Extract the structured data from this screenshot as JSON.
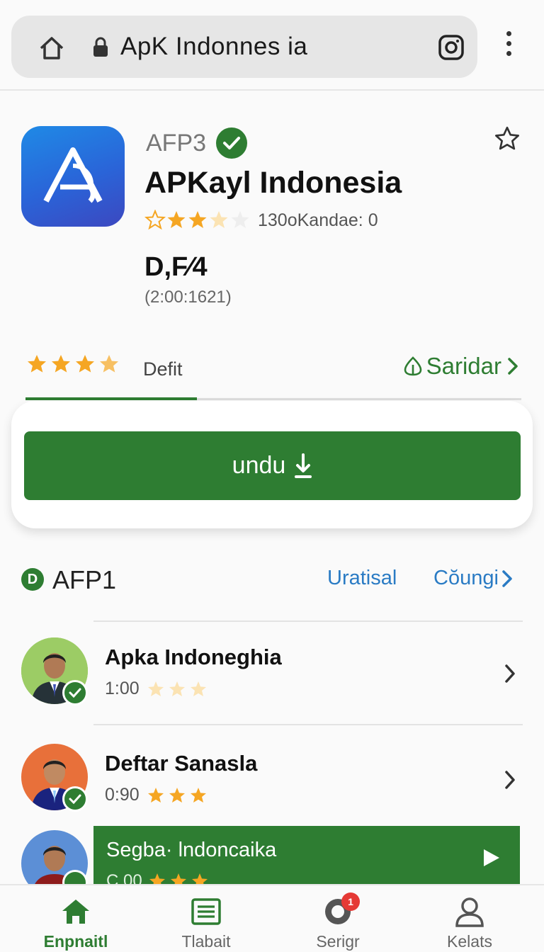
{
  "browser": {
    "url_text": "ApK Indonnes ia",
    "icons": [
      "home-icon",
      "lock-icon",
      "instagram-icon",
      "more-vert-icon"
    ]
  },
  "app": {
    "developer": "AFP3",
    "title": "APKayl Indonesia",
    "rating_count_text": "130oKandae: 0",
    "rating_fraction": 0.6,
    "size_big": "D,F⁄4",
    "size_small": "(2:00:1621)"
  },
  "tabs": {
    "label": "Defit",
    "right_label": "Saridar",
    "rating_fraction": 0.9
  },
  "download": {
    "label": "undu"
  },
  "section": {
    "badge": "D",
    "title": "AFP1",
    "link1": "Uratisal",
    "link2": "Cŏungi"
  },
  "list": [
    {
      "title": "Apka Indoneghia",
      "meta": "1:00",
      "stars_fraction": 0.0
    },
    {
      "title": "Deftar Sanasla",
      "meta": "0:90",
      "stars_fraction": 1.0
    }
  ],
  "featured": {
    "title": "Segba· lndoncaika",
    "meta": "C.00"
  },
  "nav": [
    {
      "label": "Enpnaitl",
      "icon": "home-icon",
      "active": true
    },
    {
      "label": "Tlabait",
      "icon": "list-icon",
      "active": false
    },
    {
      "label": "Serigr",
      "icon": "circle-icon",
      "active": false,
      "badge": "1"
    },
    {
      "label": "Kelats",
      "icon": "person-icon",
      "active": false
    }
  ],
  "colors": {
    "accent": "#2e7d32",
    "link": "#2a7bc4",
    "star": "#f5a623"
  }
}
